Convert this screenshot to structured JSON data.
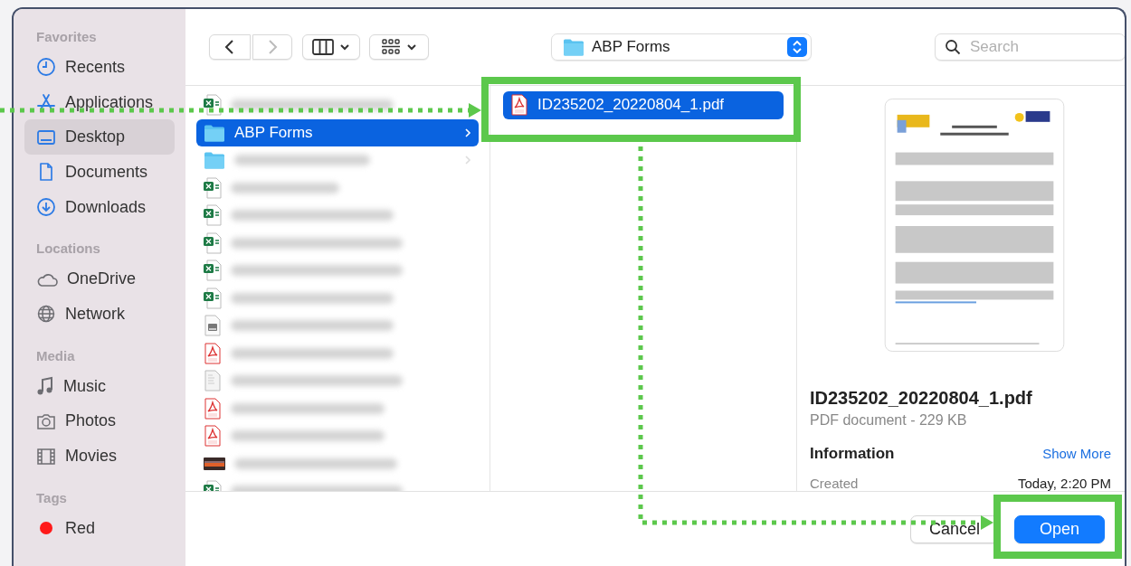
{
  "sidebar": {
    "sections": [
      {
        "heading": "Favorites",
        "items": [
          {
            "label": "Recents",
            "selected": false
          },
          {
            "label": "Applications",
            "selected": false
          },
          {
            "label": "Desktop",
            "selected": true
          },
          {
            "label": "Documents",
            "selected": false
          },
          {
            "label": "Downloads",
            "selected": false
          }
        ]
      },
      {
        "heading": "Locations",
        "items": [
          {
            "label": "OneDrive",
            "selected": false
          },
          {
            "label": "Network",
            "selected": false
          }
        ]
      },
      {
        "heading": "Media",
        "items": [
          {
            "label": "Music",
            "selected": false
          },
          {
            "label": "Photos",
            "selected": false
          },
          {
            "label": "Movies",
            "selected": false
          }
        ]
      },
      {
        "heading": "Tags",
        "items": [
          {
            "label": "Red",
            "selected": false,
            "color": "#ff1a1a"
          }
        ]
      }
    ]
  },
  "toolbar": {
    "location": "ABP Forms",
    "search": {
      "placeholder": "Search"
    }
  },
  "columns": [
    {
      "rows": [
        {
          "kind": "excel",
          "selected": false
        },
        {
          "kind": "folder",
          "name": "ABP Forms",
          "selected": true
        },
        {
          "kind": "folder",
          "selected": false
        },
        {
          "kind": "excel",
          "selected": false
        },
        {
          "kind": "excel",
          "selected": false
        },
        {
          "kind": "excel",
          "selected": false
        },
        {
          "kind": "excel",
          "selected": false
        },
        {
          "kind": "excel",
          "selected": false
        },
        {
          "kind": "dmg",
          "selected": false
        },
        {
          "kind": "pdf",
          "selected": false
        },
        {
          "kind": "rtf",
          "selected": false
        },
        {
          "kind": "pdf",
          "selected": false
        },
        {
          "kind": "pdf",
          "selected": false
        },
        {
          "kind": "pptx",
          "selected": false
        },
        {
          "kind": "excel",
          "selected": false
        }
      ]
    },
    {
      "rows": [
        {
          "kind": "pdf",
          "name": "ID235202_20220804_1.pdf",
          "selected": true
        }
      ]
    }
  ],
  "preview": {
    "filename": "ID235202_20220804_1.pdf",
    "type_size": "PDF document - 229 KB",
    "info_heading": "Information",
    "show_more": "Show More",
    "fields": [
      {
        "label": "Created",
        "value": "Today, 2:20 PM"
      }
    ]
  },
  "buttons": [
    {
      "label": "Cancel",
      "kind": "secondary"
    },
    {
      "label": "Open",
      "kind": "primary"
    }
  ]
}
